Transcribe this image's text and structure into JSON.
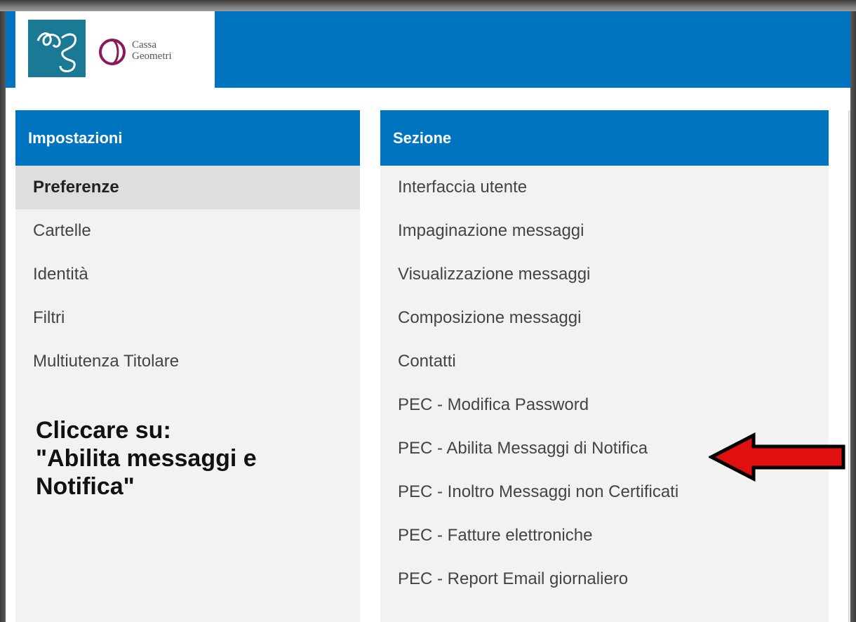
{
  "logo": {
    "line1": "Cassa",
    "line2": "Geometri",
    "colors": {
      "square": "#1a7a96",
      "circle": "#8b1a5a"
    }
  },
  "header": {
    "color": "#0074c1"
  },
  "settings_panel": {
    "title": "Impostazioni",
    "items": [
      "Preferenze",
      "Cartelle",
      "Identità",
      "Filtri",
      "Multiutenza Titolare"
    ],
    "selected_index": 0
  },
  "section_panel": {
    "title": "Sezione",
    "items": [
      "Interfaccia utente",
      "Impaginazione messaggi",
      "Visualizzazione messaggi",
      "Composizione messaggi",
      "Contatti",
      "PEC - Modifica Password",
      "PEC - Abilita Messaggi di Notifica",
      "PEC - Inoltro Messaggi non Certificati",
      "PEC - Fatture elettroniche",
      "PEC - Report Email giornaliero"
    ]
  },
  "annotation": {
    "line1": "Cliccare su:",
    "line2": "\"Abilita messaggi e",
    "line3": "Notifica\"",
    "arrow_icon": "red-arrow-left-icon",
    "arrow_color": "#e01010"
  }
}
